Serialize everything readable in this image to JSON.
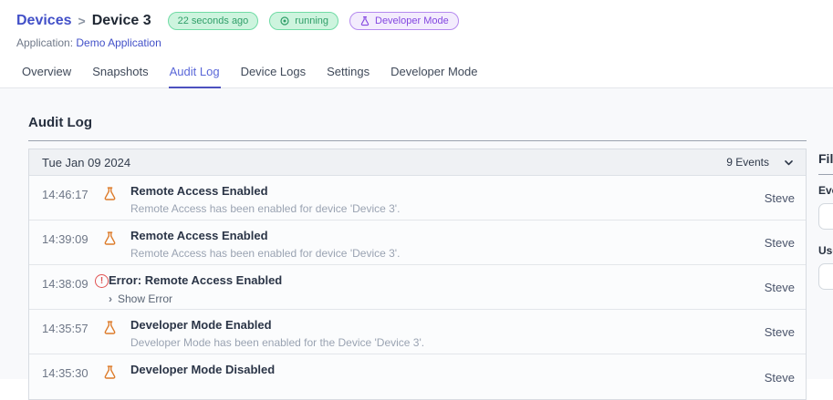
{
  "header": {
    "breadcrumb": {
      "parent": "Devices",
      "separator": ">",
      "current": "Device 3"
    },
    "badges": [
      {
        "label": "22 seconds ago",
        "color": "green",
        "icon": "none"
      },
      {
        "label": "running",
        "color": "green",
        "icon": "status-dot"
      },
      {
        "label": "Developer Mode",
        "color": "purple",
        "icon": "flask"
      }
    ],
    "application_label": "Application:",
    "application_name": "Demo Application"
  },
  "tabs": {
    "active": "Audit Log",
    "items": [
      {
        "label": "Overview"
      },
      {
        "label": "Snapshots"
      },
      {
        "label": "Audit Log"
      },
      {
        "label": "Device Logs"
      },
      {
        "label": "Settings"
      },
      {
        "label": "Developer Mode"
      }
    ]
  },
  "audit_log": {
    "title": "Audit Log",
    "group": {
      "date": "Tue Jan 09 2024",
      "events_count": "9 Events"
    },
    "rows": [
      {
        "time": "14:46:17",
        "icon": "flask",
        "title": "Remote Access Enabled",
        "description": "Remote Access has been enabled for device 'Device 3'.",
        "user": "Steve"
      },
      {
        "time": "14:39:09",
        "icon": "flask",
        "title": "Remote Access Enabled",
        "description": "Remote Access has been enabled for device 'Device 3'.",
        "user": "Steve"
      },
      {
        "time": "14:38:09",
        "icon": "error",
        "title": "Error: Remote Access Enabled",
        "show_error": "Show Error",
        "user": "Steve"
      },
      {
        "time": "14:35:57",
        "icon": "flask",
        "title": "Developer Mode Enabled",
        "description": "Developer Mode has been enabled for the Device 'Device 3'.",
        "user": "Steve"
      },
      {
        "time": "14:35:30",
        "icon": "flask",
        "title": "Developer Mode Disabled",
        "user": "Steve"
      }
    ]
  },
  "filter_panel": {
    "title": "Filter",
    "event_type_label": "Event Type",
    "event_type_value": "",
    "user_label": "User",
    "user_value": ""
  },
  "colors": {
    "accent_indigo": "#4c51bf",
    "active_tab": "#5a67d8",
    "badge_green_text": "#2f9e68",
    "badge_purple_text": "#8447e0",
    "flask_orange": "#dd7b2a",
    "error_red": "#e05252"
  }
}
